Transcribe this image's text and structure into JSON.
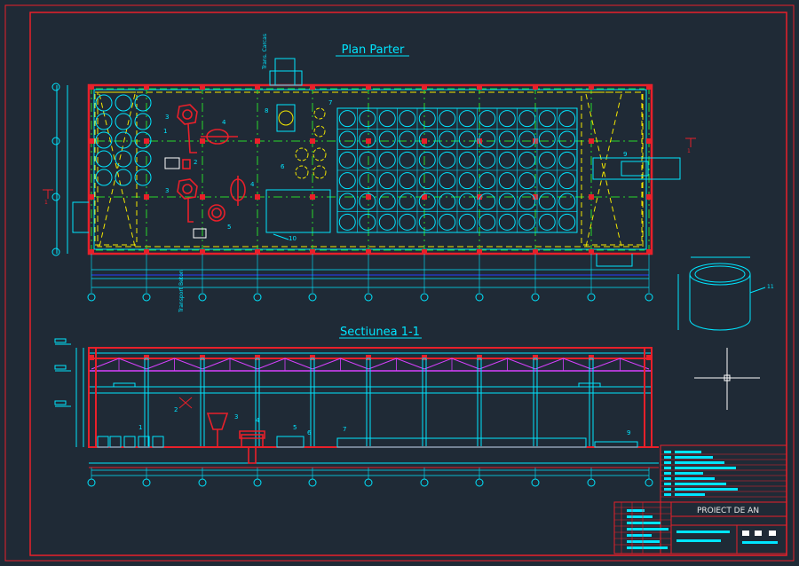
{
  "drawing": {
    "plan_title": "Plan Parter",
    "section_title": "Sectiunea 1-1",
    "project_label": "PROIECT DE AN",
    "label_transport_top": "Trans. Carcas",
    "label_transport_side": "Transport Beton"
  },
  "plan": {
    "item_labels": [
      "1",
      "2",
      "3",
      "3",
      "4",
      "4",
      "5",
      "6",
      "7",
      "8",
      "9",
      "10"
    ],
    "marker_labels": [
      "1",
      "1"
    ],
    "tank_grid": {
      "cols": 12,
      "rows": 6
    },
    "left_tanks": {
      "cols": 3,
      "rows": 5
    }
  },
  "section": {
    "item_labels": [
      "1",
      "2",
      "3",
      "4",
      "5",
      "6",
      "7",
      "9"
    ]
  },
  "detail": {
    "label": "11"
  },
  "colors": {
    "background": "#1f2a36",
    "frame_red": "#e8202a",
    "line_cyan": "#00e5ff",
    "dash_yellow": "#f5e900",
    "dash_green": "#29d82b",
    "magenta": "#d840ff",
    "blue": "#2a3cff",
    "white": "#ffffff"
  }
}
